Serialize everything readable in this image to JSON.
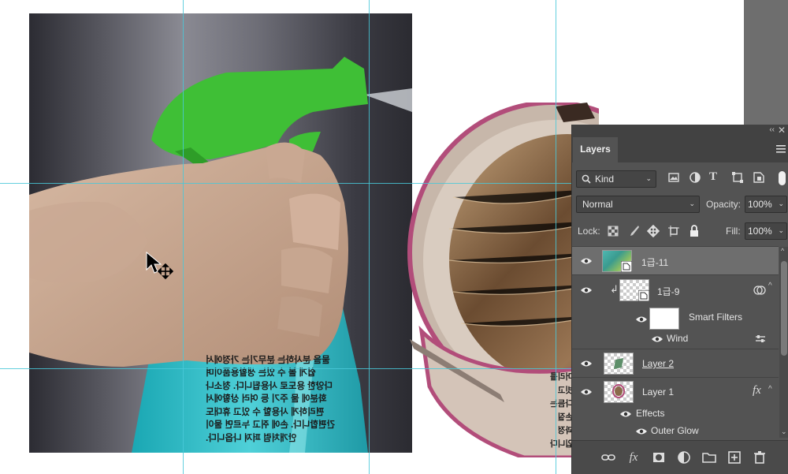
{
  "photo_caption_lines": [
    "물을 분사하는 분무기는 가정에서",
    "쉽게 볼 수 있는 생활용품이며",
    "다양한 용도로 사용됩니다. 청소나",
    "화분에 물 주기 등 여러 상황에서",
    "편리하게 사용할 수 있고 휴대도",
    "간편합니다. 손에 쥐고 누르면 물이",
    "안개처럼 퍼져 나옵니다."
  ],
  "hair_caption_lines": [
    "머리를",
    "빗고",
    "다듬는",
    "손질",
    "과정",
    "입니다"
  ],
  "panel": {
    "tab_label": "Layers",
    "collapse_glyph": "‹‹",
    "close_glyph": "✕",
    "filter": {
      "kind_label": "Kind"
    },
    "blend_mode": "Normal",
    "opacity_label": "Opacity:",
    "opacity_value": "100%",
    "lock_label": "Lock:",
    "fill_label": "Fill:",
    "fill_value": "100%",
    "layers": [
      {
        "name": "1급-11",
        "selected": true
      },
      {
        "name": "1급-9"
      },
      {
        "name": "Smart Filters"
      },
      {
        "name": "Wind"
      },
      {
        "name": "Layer 2"
      },
      {
        "name": "Layer 1",
        "fx": "fx"
      },
      {
        "name": "Effects"
      },
      {
        "name": "Outer Glow"
      }
    ],
    "bottom_icons": [
      "link-icon",
      "fx-icon",
      "mask-icon",
      "adjustment-icon",
      "folder-icon",
      "new-layer-icon",
      "trash-icon"
    ]
  },
  "colors": {
    "guide": "#49c8d8",
    "panel_bg": "#535353",
    "selected_row": "#6e6e6e"
  }
}
